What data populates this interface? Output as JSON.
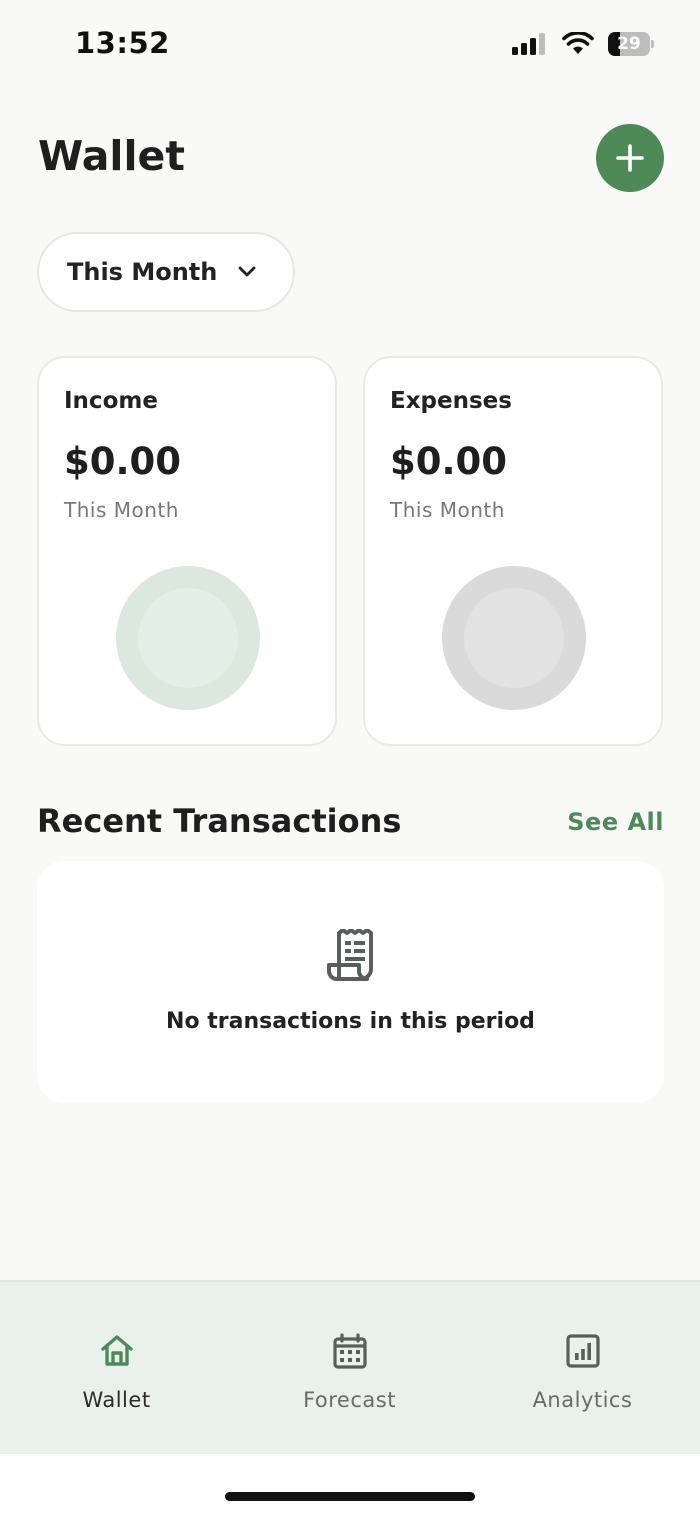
{
  "status_bar": {
    "time": "13:52",
    "battery_level": "29",
    "battery_fraction": 0.29
  },
  "header": {
    "title": "Wallet",
    "add_icon": "plus-icon"
  },
  "period_selector": {
    "selected": "This Month",
    "icon": "chevron-down-icon"
  },
  "summary": {
    "income": {
      "title": "Income",
      "amount": "$0.00",
      "period": "This Month",
      "ring_color": "#dbe8de",
      "inner_color": "#e3eee6"
    },
    "expenses": {
      "title": "Expenses",
      "amount": "$0.00",
      "period": "This Month",
      "ring_color": "#dadada",
      "inner_color": "#e2e2e2"
    }
  },
  "recent": {
    "title": "Recent Transactions",
    "see_all": "See All",
    "empty_icon": "receipt-icon",
    "empty_message": "No transactions in this period"
  },
  "tabs": [
    {
      "label": "Wallet",
      "icon": "home-icon",
      "active": true
    },
    {
      "label": "Forecast",
      "icon": "calendar-icon",
      "active": false
    },
    {
      "label": "Analytics",
      "icon": "bar-chart-icon",
      "active": false
    }
  ],
  "colors": {
    "accent": "#4d8a58",
    "background": "#f9f9f7",
    "tab_bar": "#eaf1ec"
  }
}
